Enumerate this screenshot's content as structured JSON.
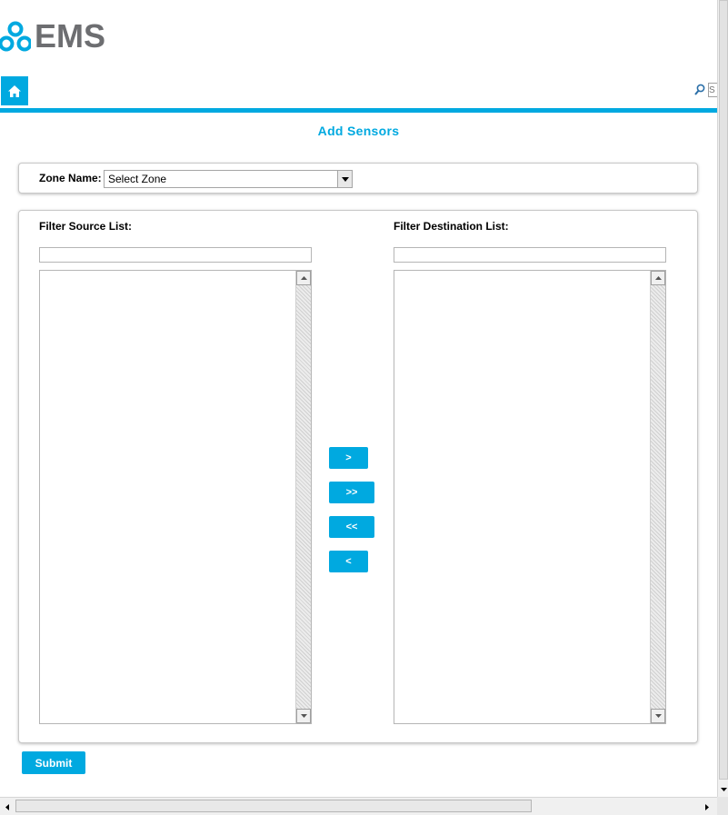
{
  "app": {
    "logo_text": "EMS",
    "accent_color": "#00a9e0",
    "logo_icon": "ems-logo-icon"
  },
  "nav": {
    "home_icon": "home-icon",
    "search_icon": "search-icon",
    "search_placeholder": "S"
  },
  "page": {
    "title": "Add Sensors"
  },
  "zone": {
    "label": "Zone Name:",
    "selected": "Select Zone"
  },
  "lists": {
    "source_label": "Filter Source List:",
    "destination_label": "Filter Destination List:",
    "source_filter_value": "",
    "destination_filter_value": "",
    "source_items": [],
    "destination_items": []
  },
  "transfer": {
    "move_selected_right": ">",
    "move_all_right": ">>",
    "move_all_left": "<<",
    "move_selected_left": "<"
  },
  "actions": {
    "submit_label": "Submit"
  }
}
